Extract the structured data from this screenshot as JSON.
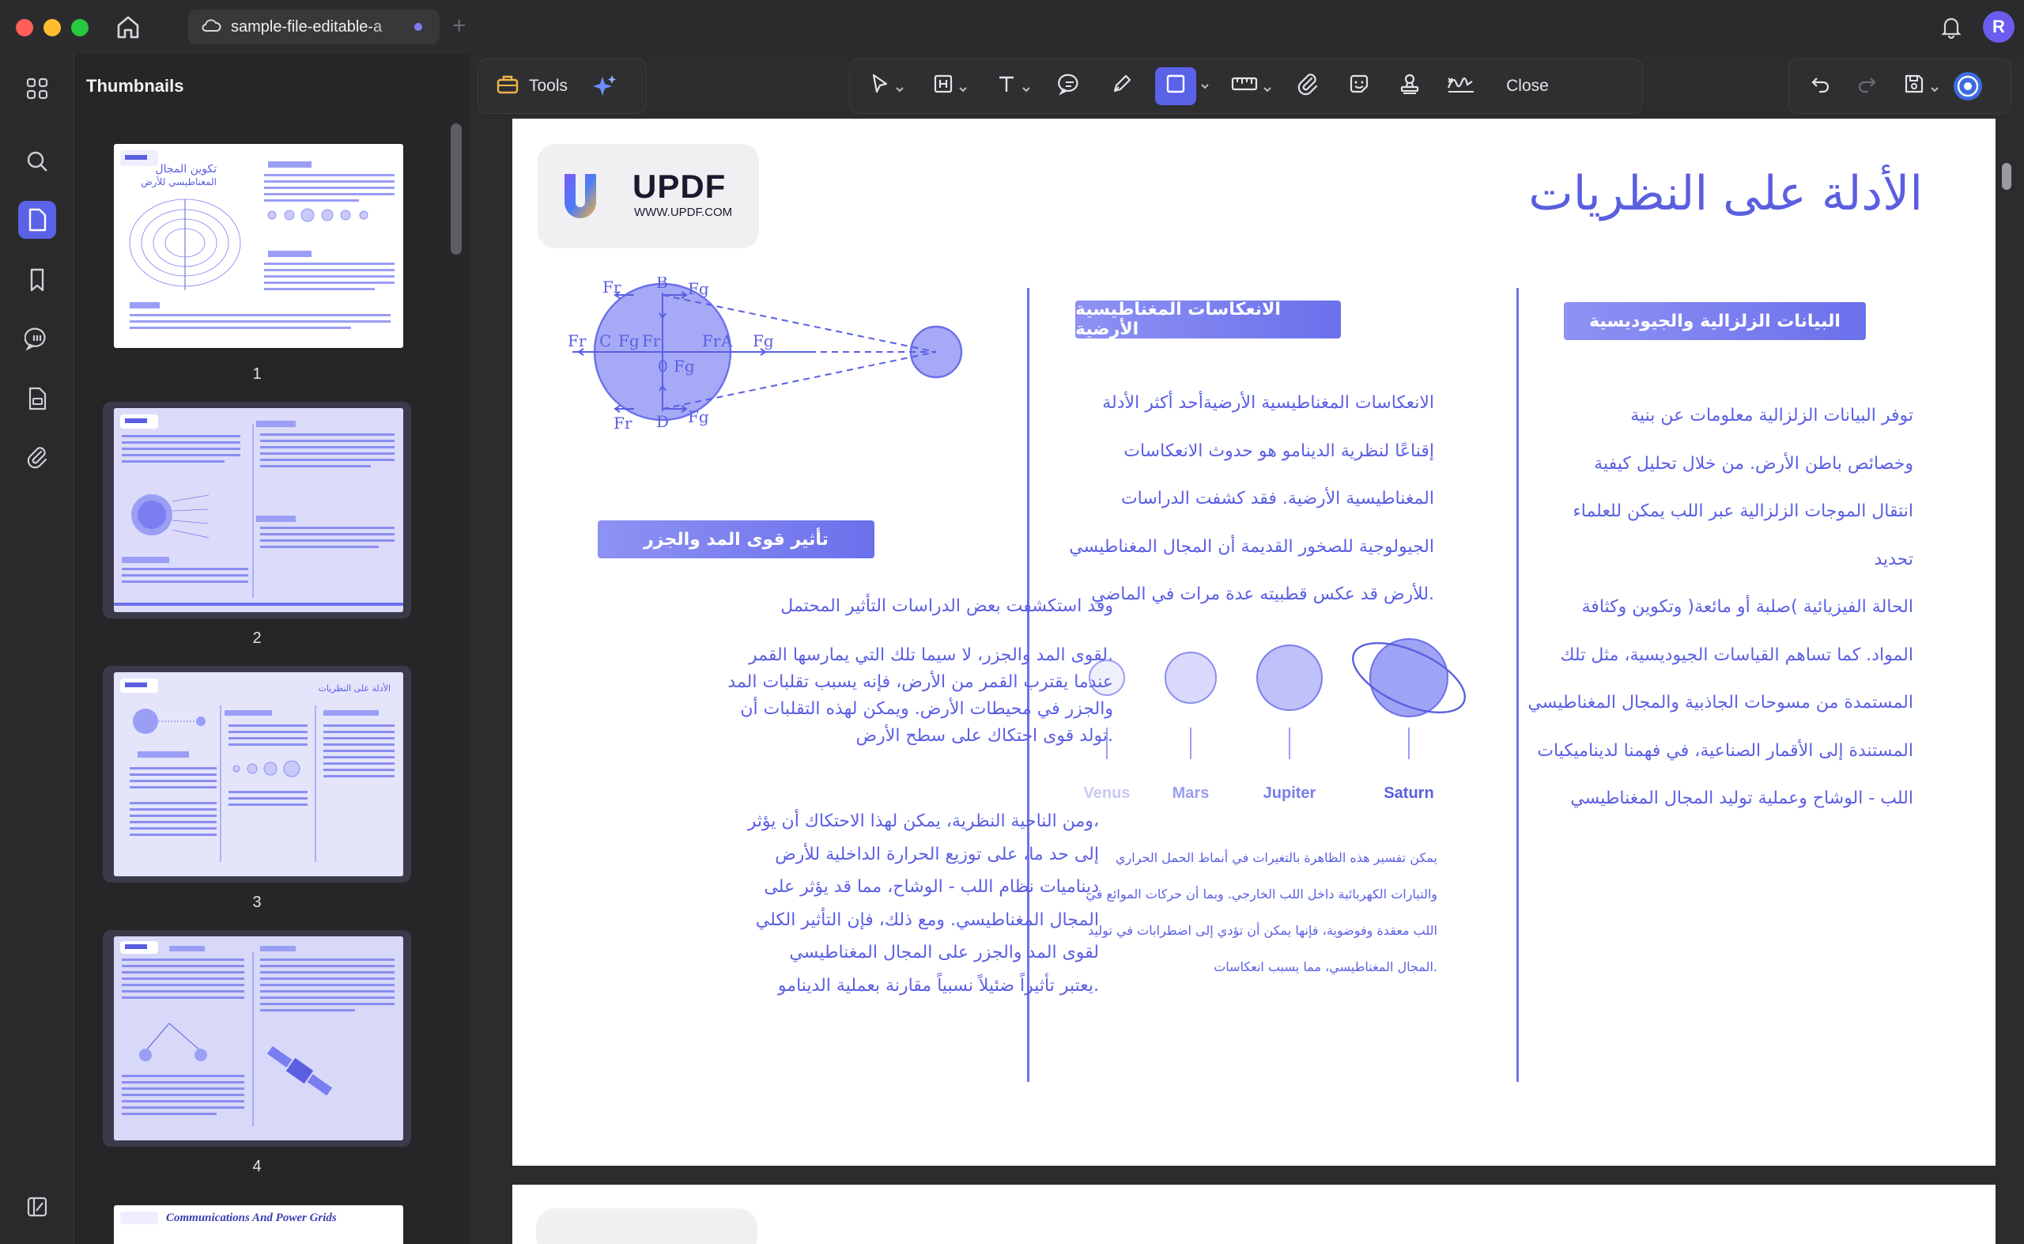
{
  "window": {
    "tab_title": "sample-file-editable-a",
    "user_initial": "R"
  },
  "sidebar": {
    "title": "Thumbnails",
    "pages": [
      "1",
      "2",
      "3",
      "4"
    ],
    "partial_page_title": "Communications And Power Grids"
  },
  "toolbar": {
    "tools_label": "Tools",
    "close_label": "Close"
  },
  "document": {
    "logo_text": "UPDF",
    "logo_url": "WWW.UPDF.COM",
    "heading": "الأدلة على النظريات",
    "col_right": {
      "pill": "البيانات الزلزالية والجيوديسية",
      "lines": [
        "توفر البيانات الزلزالية معلومات عن بنية",
        "وخصائص باطن الأرض. من خلال تحليل كيفية",
        "انتقال الموجات الزلزالية عبر اللب يمكن للعلماء",
        "تحديد",
        "الحالة الفيزيائية )صلبة أو مائعة( وتكوين وكثافة",
        "المواد. كما تساهم القياسات الجيوديسية، مثل تلك",
        "المستمدة من مسوحات الجاذبية والمجال المغناطيسي",
        "المستندة إلى الأقمار الصناعية، في فهمنا لديناميكيات",
        "اللب - الوشاح وعملية توليد المجال المغناطيسي"
      ]
    },
    "col_middle": {
      "pill": "الانعكاسات المغناطيسية الأرضية",
      "lines": [
        "الانعكاسات المغناطيسية الأرضيةأحد أكثر الأدلة",
        "إقناعًا لنظرية الدينامو هو حدوث الانعكاسات",
        "المغناطيسية الأرضية. فقد كشفت الدراسات",
        "الجيولوجية للصخور القديمة أن المجال المغناطيسي",
        ".للأرض قد عكس قطبيته عدة مرات في الماضي"
      ],
      "planets": [
        "Venus",
        "Mars",
        "Jupiter",
        "Saturn"
      ],
      "small_lines": [
        "يمكن تفسير هذه الظاهرة بالتغيرات في أنماط الحمل الحراري",
        "والتيارات الكهربائية داخل اللب الخارجي. وبما أن حركات الموائع في",
        "اللب معقدة وفوضوية، فإنها يمكن أن تؤدي إلى اضطرابات في توليد",
        ".المجال المغناطيسي، مما يسبب انعكاسات"
      ]
    },
    "col_left": {
      "pill": "تأثير قوى المد والجزر",
      "intro": "وقد استكشفت بعض الدراسات التأثير المحتمل",
      "para1": [
        ".لقوى المد والجزر، لا سيما تلك التي يمارسها القمر",
        "عندما يقترب القمر من الأرض، فإنه يسبب تقلبات المد",
        "والجزر في محيطات الأرض. ويمكن لهذه التقلبات أن",
        ".تولد قوى احتكاك على سطح الأرض"
      ],
      "para2": [
        "،ومن الناحية النظرية، يمكن لهذا الاحتكاك أن يؤثر",
        "إلى حد ما، على توزيع الحرارة الداخلية للأرض",
        "ديناميات نظام اللب - الوشاح، مما قد يؤثر على",
        "المجال المغناطيسي. ومع ذلك، فإن التأثير الكلي",
        "لقوى المد والجزر على المجال المغناطيسي",
        ".يعتبر تأثيراً ضئيلاً نسبياً مقارنة بعملية الدينامو"
      ],
      "diagram_labels": {
        "fr": "Fr",
        "fg": "Fg",
        "b": "B",
        "c": "C",
        "d": "D",
        "a": "A",
        "o": "0"
      }
    }
  }
}
